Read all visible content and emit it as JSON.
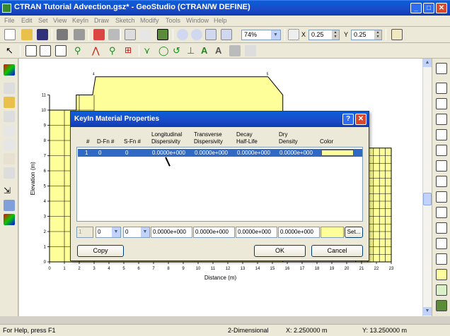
{
  "window": {
    "title": "CTRAN Tutorial Advection.gsz* - GeoStudio (CTRAN/W DEFINE)",
    "minimize": "_",
    "maximize": "□",
    "close": "✕"
  },
  "menu": [
    "File",
    "Edit",
    "Set",
    "View",
    "KeyIn",
    "Draw",
    "Sketch",
    "Modify",
    "Tools",
    "Window",
    "Help"
  ],
  "toolbar": {
    "zoom_value": "74%",
    "x_label": "X",
    "x_value": "0.25",
    "y_label": "Y",
    "y_value": "0.25"
  },
  "chart_data": {
    "type": "mesh",
    "xlabel": "Distance (m)",
    "ylabel": "Elevation (m)",
    "x_ticks": [
      0,
      1,
      2,
      3,
      4,
      5,
      6,
      7,
      8,
      9,
      10,
      11,
      12,
      13,
      14,
      15,
      16,
      17,
      18,
      19,
      20,
      21,
      22,
      23
    ],
    "y_ticks": [
      0,
      1,
      2,
      3,
      4,
      5,
      6,
      7,
      8,
      9,
      10,
      11
    ],
    "node_labels": [
      "4",
      "5"
    ]
  },
  "dialog": {
    "title": "KeyIn Material Properties",
    "help_btn": "?",
    "close_btn": "✕",
    "columns": {
      "num": "#",
      "dfn": "D-Fn #",
      "sfn": "S-Fn #",
      "long1": "Longitudinal",
      "long2": "Dispersivity",
      "trans1": "Transverse",
      "trans2": "Dispersivity",
      "decay1": "Decay",
      "decay2": "Half-Life",
      "dry1": "Dry",
      "dry2": "Density",
      "color": "Color"
    },
    "row": {
      "num": "1",
      "dfn": "0",
      "sfn": "0",
      "long": "0.0000e+000",
      "trans": "0.0000e+000",
      "decay": "0.0000e+000",
      "dry": "0.0000e+000",
      "color": "#ffff99"
    },
    "edit": {
      "num": "1",
      "dfn": "0",
      "sfn": "0",
      "long": "0.0000e+000",
      "trans": "0.0000e+000",
      "decay": "0.0000e+000",
      "dry": "0.0000e+000",
      "set": "Set..."
    },
    "copy": "Copy",
    "ok": "OK",
    "cancel": "Cancel"
  },
  "status": {
    "help": "For Help, press F1",
    "mode": "2-Dimensional",
    "x": "X: 2.250000 m",
    "y": "Y: 13.250000 m"
  }
}
